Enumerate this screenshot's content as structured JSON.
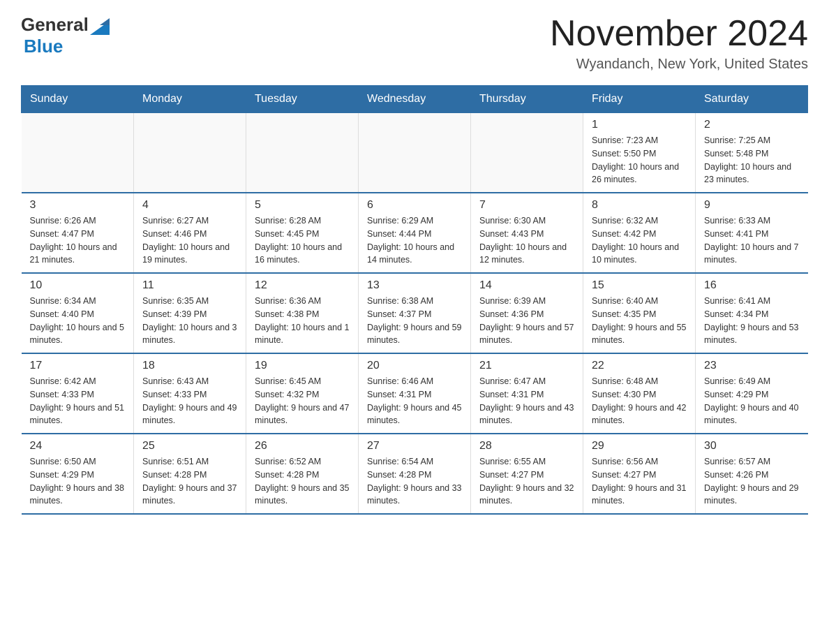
{
  "logo": {
    "general": "General",
    "blue": "Blue"
  },
  "title": "November 2024",
  "subtitle": "Wyandanch, New York, United States",
  "days_of_week": [
    "Sunday",
    "Monday",
    "Tuesday",
    "Wednesday",
    "Thursday",
    "Friday",
    "Saturday"
  ],
  "weeks": [
    [
      {
        "day": "",
        "info": ""
      },
      {
        "day": "",
        "info": ""
      },
      {
        "day": "",
        "info": ""
      },
      {
        "day": "",
        "info": ""
      },
      {
        "day": "",
        "info": ""
      },
      {
        "day": "1",
        "info": "Sunrise: 7:23 AM\nSunset: 5:50 PM\nDaylight: 10 hours and 26 minutes."
      },
      {
        "day": "2",
        "info": "Sunrise: 7:25 AM\nSunset: 5:48 PM\nDaylight: 10 hours and 23 minutes."
      }
    ],
    [
      {
        "day": "3",
        "info": "Sunrise: 6:26 AM\nSunset: 4:47 PM\nDaylight: 10 hours and 21 minutes."
      },
      {
        "day": "4",
        "info": "Sunrise: 6:27 AM\nSunset: 4:46 PM\nDaylight: 10 hours and 19 minutes."
      },
      {
        "day": "5",
        "info": "Sunrise: 6:28 AM\nSunset: 4:45 PM\nDaylight: 10 hours and 16 minutes."
      },
      {
        "day": "6",
        "info": "Sunrise: 6:29 AM\nSunset: 4:44 PM\nDaylight: 10 hours and 14 minutes."
      },
      {
        "day": "7",
        "info": "Sunrise: 6:30 AM\nSunset: 4:43 PM\nDaylight: 10 hours and 12 minutes."
      },
      {
        "day": "8",
        "info": "Sunrise: 6:32 AM\nSunset: 4:42 PM\nDaylight: 10 hours and 10 minutes."
      },
      {
        "day": "9",
        "info": "Sunrise: 6:33 AM\nSunset: 4:41 PM\nDaylight: 10 hours and 7 minutes."
      }
    ],
    [
      {
        "day": "10",
        "info": "Sunrise: 6:34 AM\nSunset: 4:40 PM\nDaylight: 10 hours and 5 minutes."
      },
      {
        "day": "11",
        "info": "Sunrise: 6:35 AM\nSunset: 4:39 PM\nDaylight: 10 hours and 3 minutes."
      },
      {
        "day": "12",
        "info": "Sunrise: 6:36 AM\nSunset: 4:38 PM\nDaylight: 10 hours and 1 minute."
      },
      {
        "day": "13",
        "info": "Sunrise: 6:38 AM\nSunset: 4:37 PM\nDaylight: 9 hours and 59 minutes."
      },
      {
        "day": "14",
        "info": "Sunrise: 6:39 AM\nSunset: 4:36 PM\nDaylight: 9 hours and 57 minutes."
      },
      {
        "day": "15",
        "info": "Sunrise: 6:40 AM\nSunset: 4:35 PM\nDaylight: 9 hours and 55 minutes."
      },
      {
        "day": "16",
        "info": "Sunrise: 6:41 AM\nSunset: 4:34 PM\nDaylight: 9 hours and 53 minutes."
      }
    ],
    [
      {
        "day": "17",
        "info": "Sunrise: 6:42 AM\nSunset: 4:33 PM\nDaylight: 9 hours and 51 minutes."
      },
      {
        "day": "18",
        "info": "Sunrise: 6:43 AM\nSunset: 4:33 PM\nDaylight: 9 hours and 49 minutes."
      },
      {
        "day": "19",
        "info": "Sunrise: 6:45 AM\nSunset: 4:32 PM\nDaylight: 9 hours and 47 minutes."
      },
      {
        "day": "20",
        "info": "Sunrise: 6:46 AM\nSunset: 4:31 PM\nDaylight: 9 hours and 45 minutes."
      },
      {
        "day": "21",
        "info": "Sunrise: 6:47 AM\nSunset: 4:31 PM\nDaylight: 9 hours and 43 minutes."
      },
      {
        "day": "22",
        "info": "Sunrise: 6:48 AM\nSunset: 4:30 PM\nDaylight: 9 hours and 42 minutes."
      },
      {
        "day": "23",
        "info": "Sunrise: 6:49 AM\nSunset: 4:29 PM\nDaylight: 9 hours and 40 minutes."
      }
    ],
    [
      {
        "day": "24",
        "info": "Sunrise: 6:50 AM\nSunset: 4:29 PM\nDaylight: 9 hours and 38 minutes."
      },
      {
        "day": "25",
        "info": "Sunrise: 6:51 AM\nSunset: 4:28 PM\nDaylight: 9 hours and 37 minutes."
      },
      {
        "day": "26",
        "info": "Sunrise: 6:52 AM\nSunset: 4:28 PM\nDaylight: 9 hours and 35 minutes."
      },
      {
        "day": "27",
        "info": "Sunrise: 6:54 AM\nSunset: 4:28 PM\nDaylight: 9 hours and 33 minutes."
      },
      {
        "day": "28",
        "info": "Sunrise: 6:55 AM\nSunset: 4:27 PM\nDaylight: 9 hours and 32 minutes."
      },
      {
        "day": "29",
        "info": "Sunrise: 6:56 AM\nSunset: 4:27 PM\nDaylight: 9 hours and 31 minutes."
      },
      {
        "day": "30",
        "info": "Sunrise: 6:57 AM\nSunset: 4:26 PM\nDaylight: 9 hours and 29 minutes."
      }
    ]
  ]
}
